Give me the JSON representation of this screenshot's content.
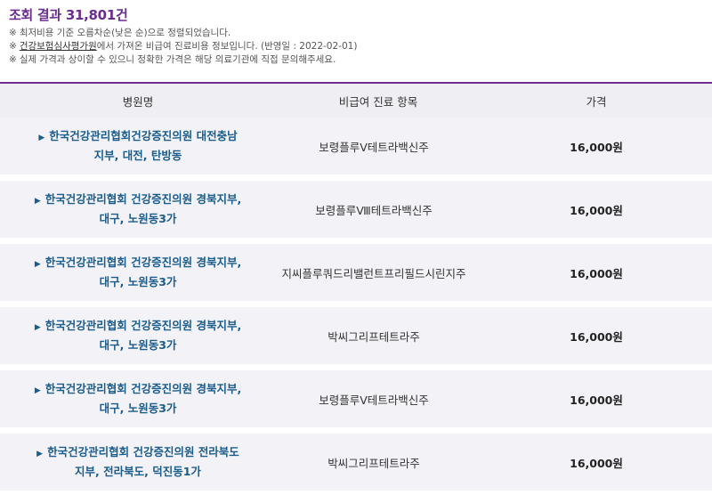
{
  "summary": {
    "title_prefix": "조회 결과",
    "count": "31,801건",
    "notes": [
      {
        "mark": "※",
        "text": "최저비용 기준 오름차순(낮은 순)으로 정렬되었습니다."
      },
      {
        "mark": "※",
        "link": "건강보험심사평가원",
        "text": "에서 가져온 비급여 진료비용 정보입니다. (반영일 : 2022-02-01)"
      },
      {
        "mark": "※",
        "text": "실제 가격과 상이할 수 있으니 정확한 가격은 해당 의료기관에 직접 문의해주세요."
      }
    ]
  },
  "table": {
    "headers": {
      "name": "병원명",
      "item": "비급여 진료 항목",
      "price": "가격"
    },
    "rows": [
      {
        "name": "한국건강관리협회건강증진의원 대전충남\n지부, 대전, 탄방동",
        "item": "보령플루Ⅴ테트라백신주",
        "price": "16,000원"
      },
      {
        "name": "한국건강관리협회 건강증진의원 경북지부,\n대구, 노원동3가",
        "item": "보령플루Ⅷ테트라백신주",
        "price": "16,000원"
      },
      {
        "name": "한국건강관리협회 건강증진의원 경북지부,\n대구, 노원동3가",
        "item": "지씨플루쿼드리밸런트프리필드시린지주",
        "price": "16,000원"
      },
      {
        "name": "한국건강관리협회 건강증진의원 경북지부,\n대구, 노원동3가",
        "item": "박씨그리프테트라주",
        "price": "16,000원"
      },
      {
        "name": "한국건강관리협회 건강증진의원 경북지부,\n대구, 노원동3가",
        "item": "보령플루Ⅴ테트라백신주",
        "price": "16,000원"
      },
      {
        "name": "한국건강관리협회 건강증진의원 전라북도\n지부, 전라북도, 덕진동1가",
        "item": "박씨그리프테트라주",
        "price": "16,000원"
      }
    ]
  },
  "colors": {
    "accent": "#6b2d8f",
    "link": "#1a5c8c",
    "row_bg": "#f3f3f7",
    "header_bg": "#eeeef3"
  },
  "icons": {
    "row_arrow": "triangle-right-icon"
  }
}
